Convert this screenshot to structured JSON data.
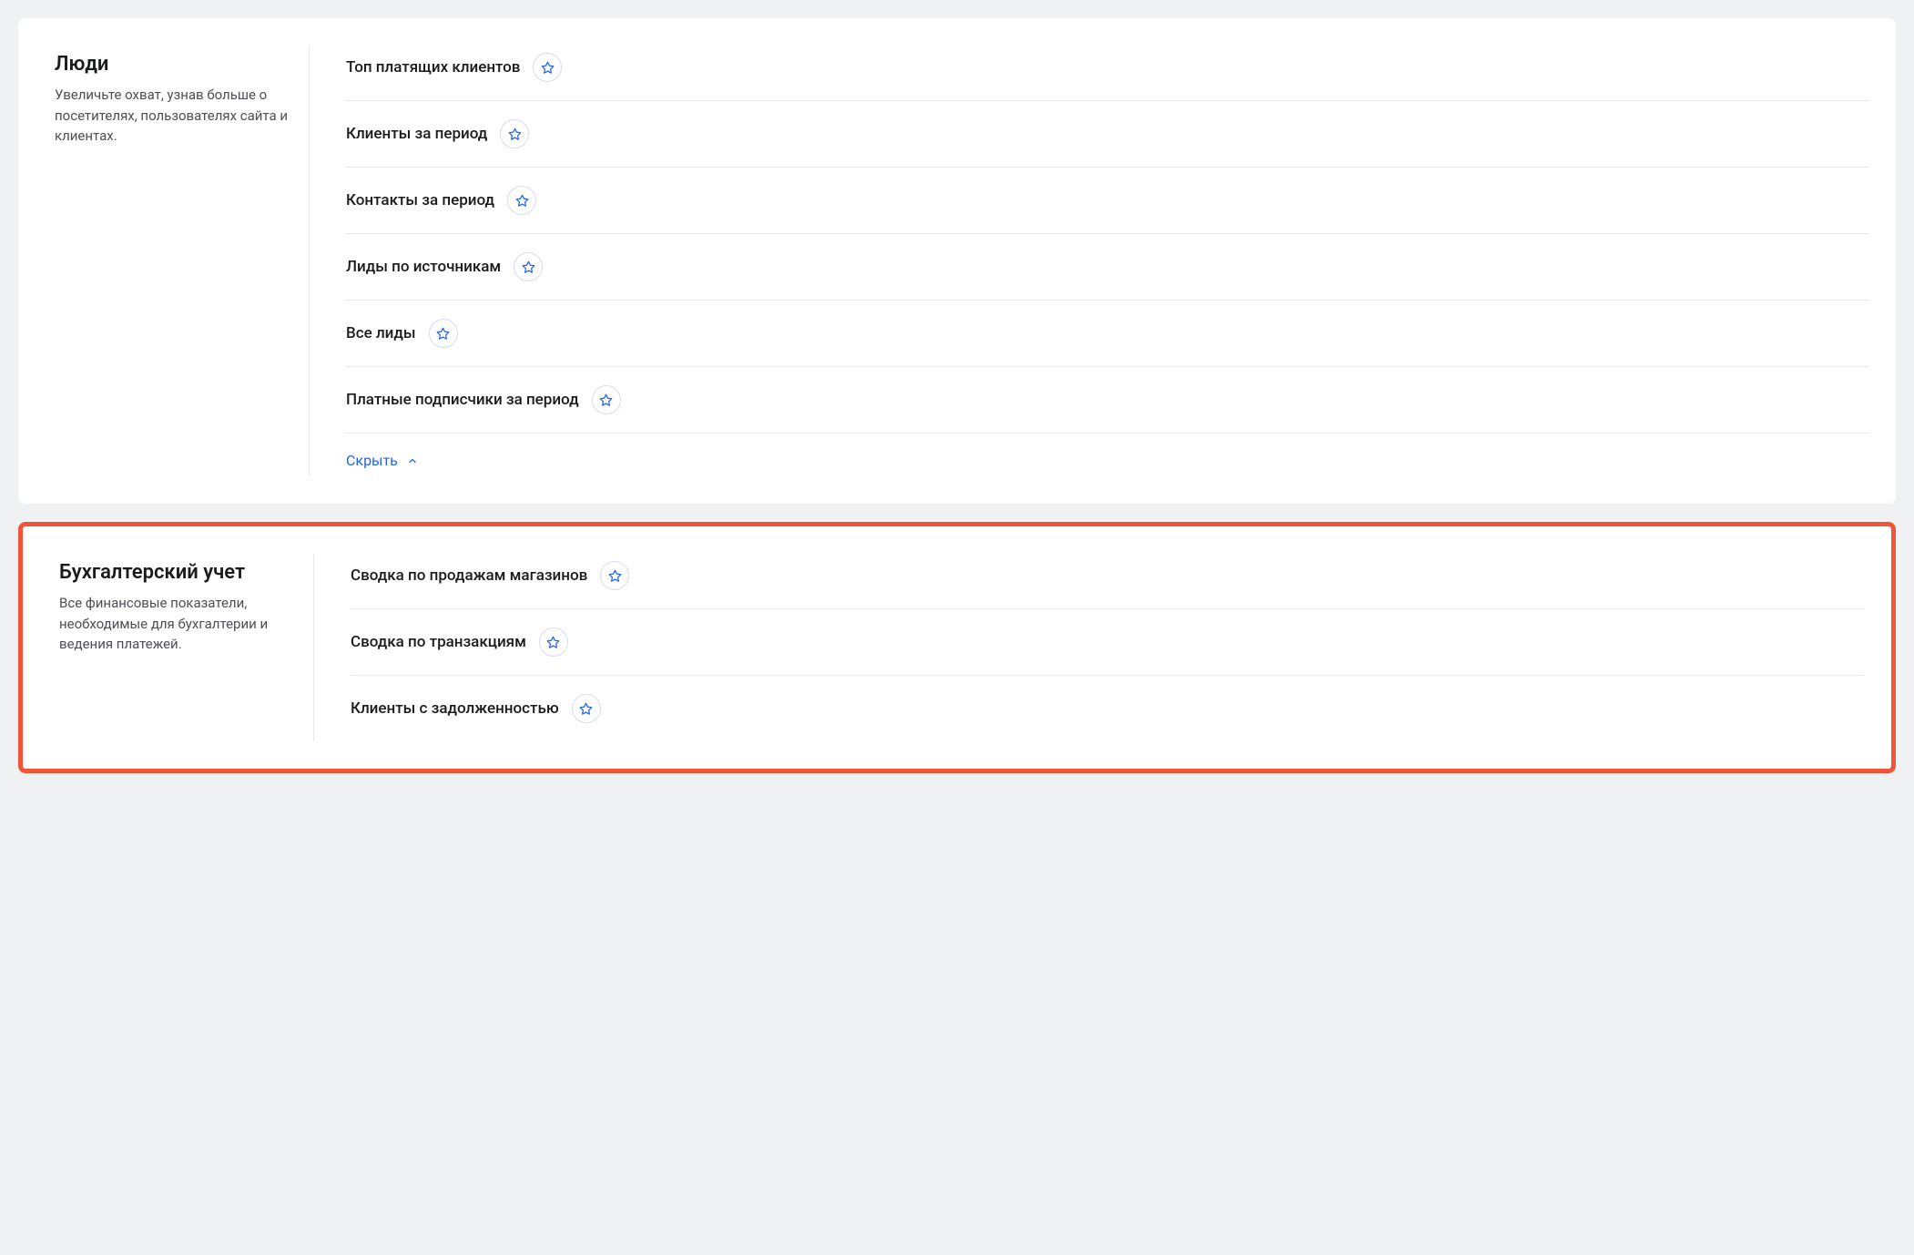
{
  "sections": [
    {
      "title": "Люди",
      "description": "Увеличьте охват, узнав больше о посетителях, пользователях сайта и клиентах.",
      "highlighted": false,
      "items": [
        {
          "label": "Топ платящих клиентов"
        },
        {
          "label": "Клиенты за период"
        },
        {
          "label": "Контакты за период"
        },
        {
          "label": "Лиды по источникам"
        },
        {
          "label": "Все лиды"
        },
        {
          "label": "Платные подписчики за период"
        }
      ],
      "collapse_label": "Скрыть"
    },
    {
      "title": "Бухгалтерский учет",
      "description": "Все финансовые показатели, необходимые для бухгалтерии и ведения платежей.",
      "highlighted": true,
      "items": [
        {
          "label": "Сводка по продажам магазинов"
        },
        {
          "label": "Сводка по транзакциям"
        },
        {
          "label": "Клиенты с задолженностью"
        }
      ]
    }
  ],
  "colors": {
    "accent_blue": "#2563eb",
    "highlight_border": "#f2533b",
    "star_stroke": "#2563eb"
  }
}
